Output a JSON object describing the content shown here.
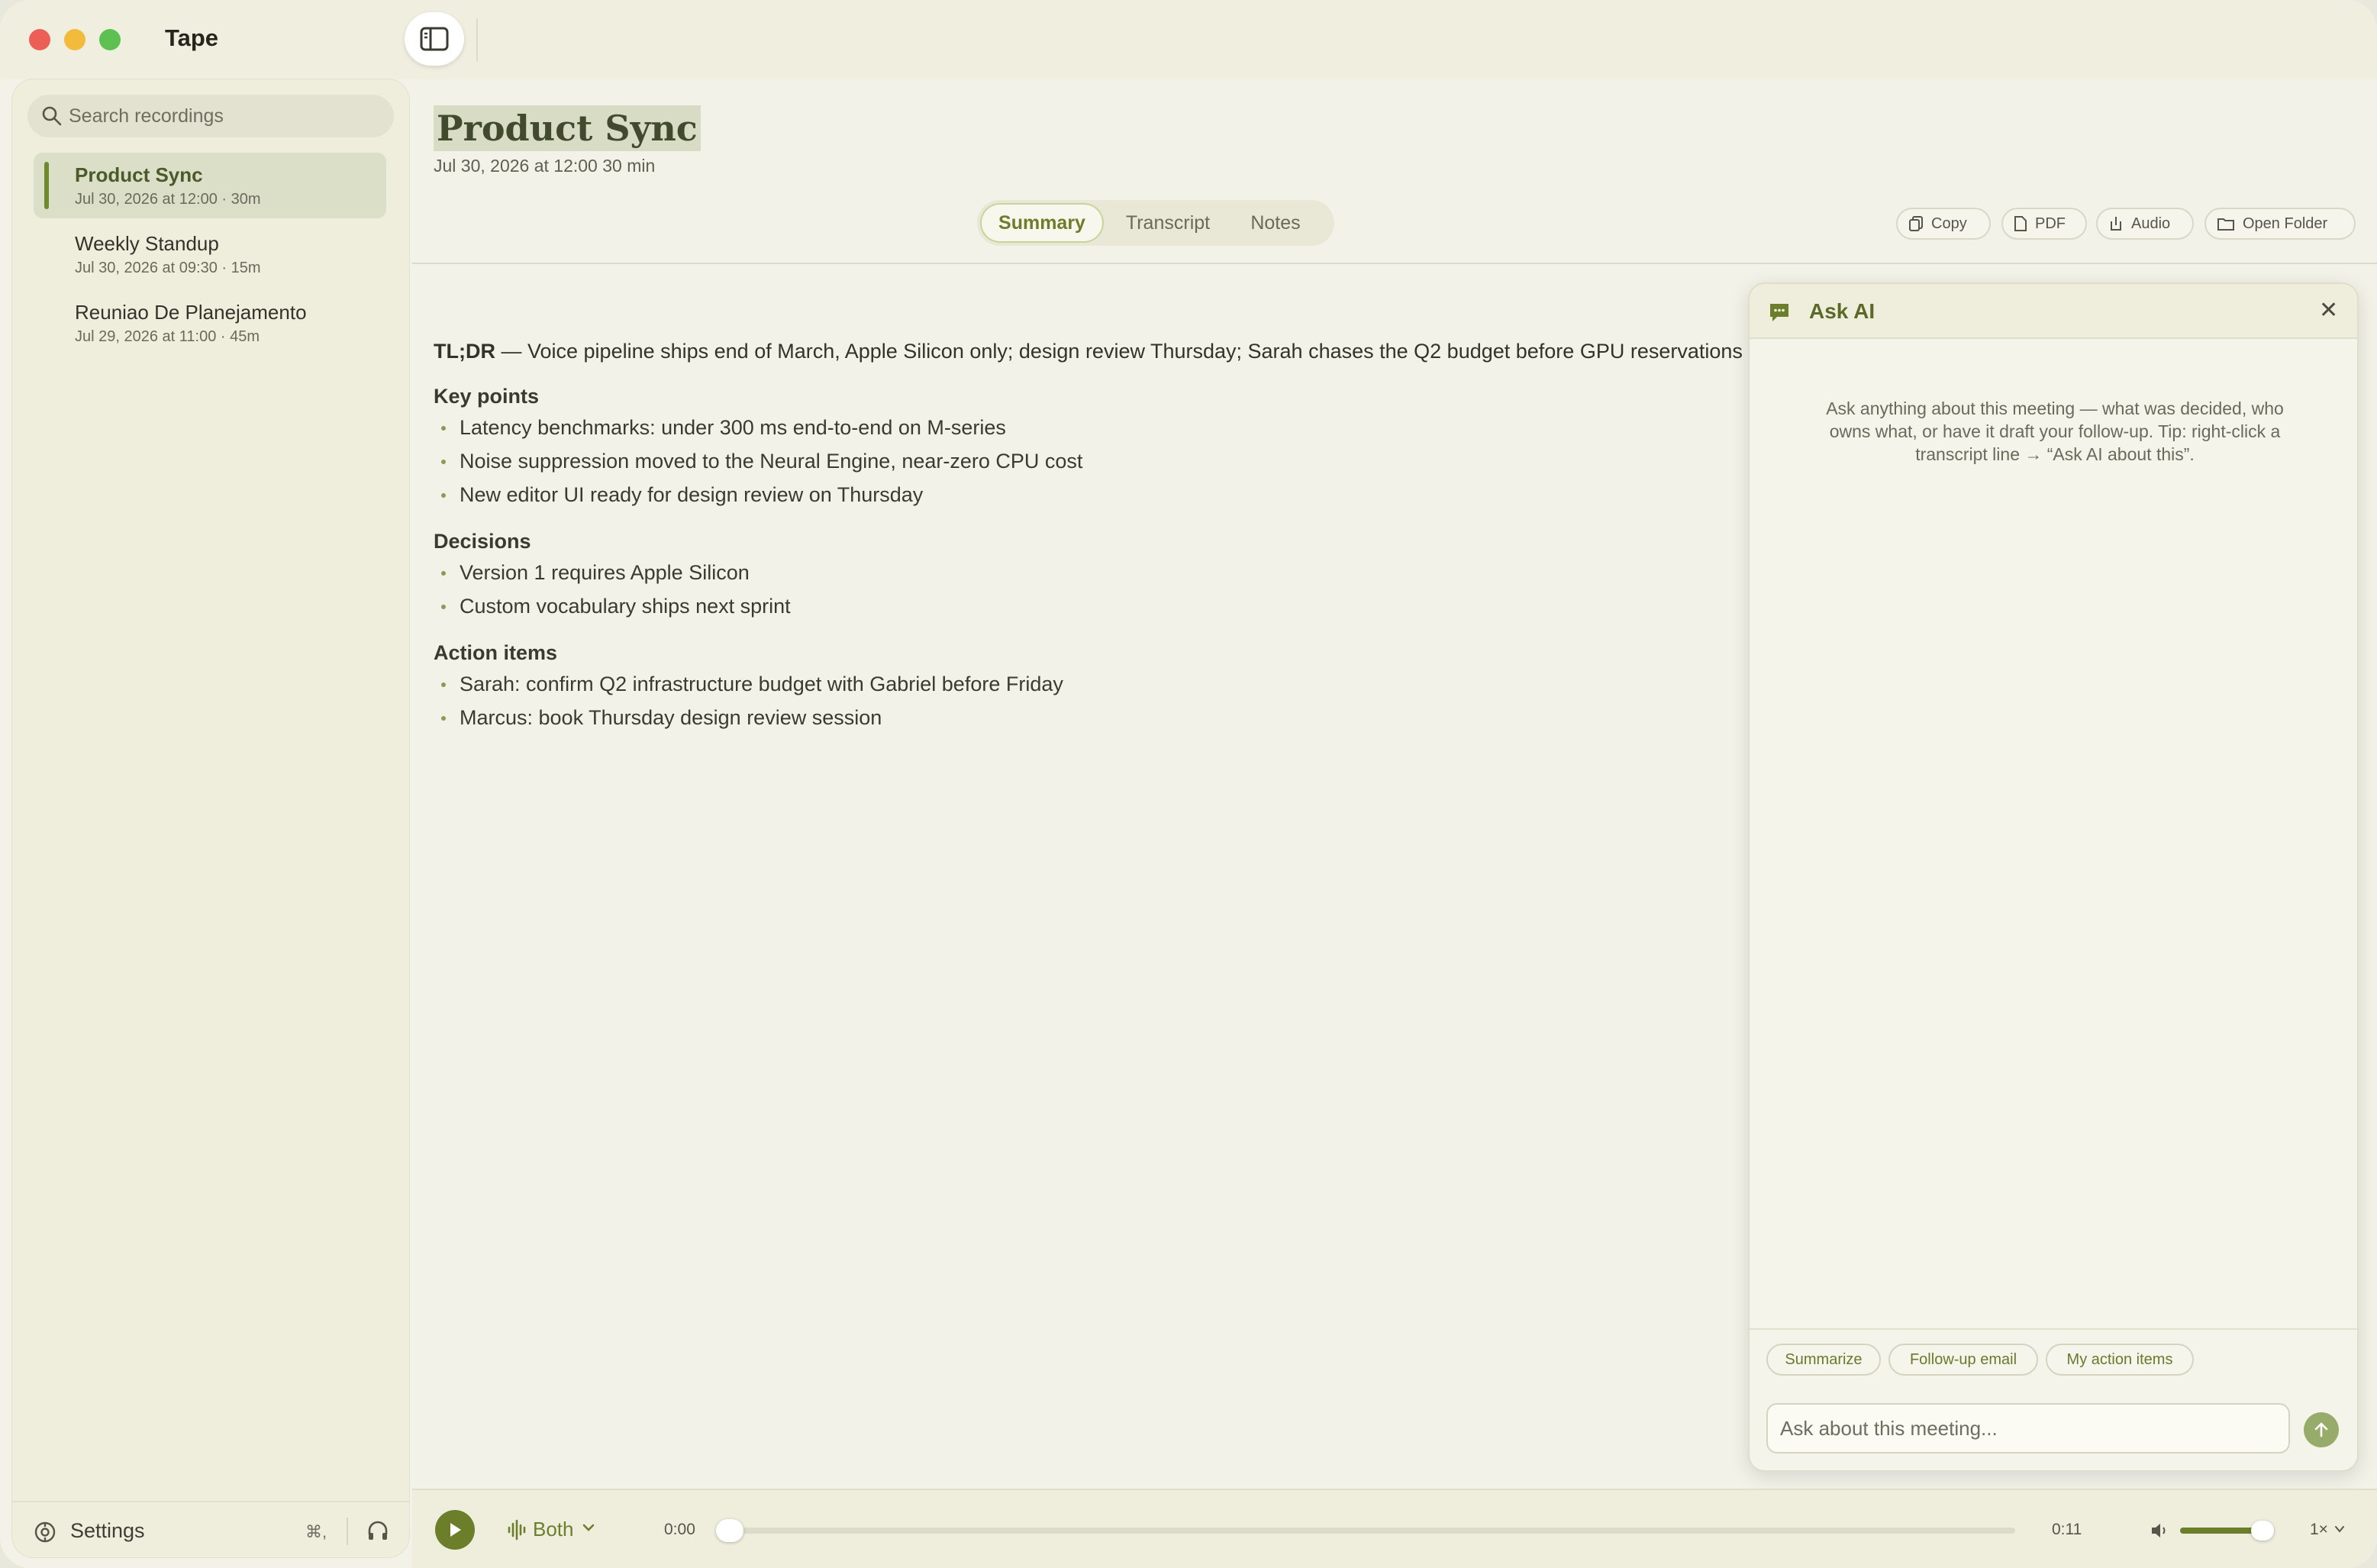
{
  "app": {
    "title": "Tape"
  },
  "sidebar": {
    "search_placeholder": "Search recordings",
    "recordings": [
      {
        "name": "Product Sync",
        "meta": "Jul 30, 2026 at 12:00  · 30m",
        "active": true
      },
      {
        "name": "Weekly Standup",
        "meta": "Jul 30, 2026 at 09:30  · 15m",
        "active": false
      },
      {
        "name": "Reuniao De Planejamento",
        "meta": "Jul 29, 2026 at 11:00  · 45m",
        "active": false
      }
    ],
    "footer": {
      "settings_label": "Settings",
      "shortcut": "⌘,"
    }
  },
  "document": {
    "title": "Product Sync",
    "meta": "Jul 30, 2026 at 12:00   30 min",
    "tabs": [
      "Summary",
      "Transcript",
      "Notes"
    ],
    "active_tab": "Summary",
    "actions": [
      "Copy",
      "PDF",
      "Audio",
      "Open Folder"
    ]
  },
  "summary": {
    "tldr_label": "TL;DR",
    "tldr_text": " — Voice pipeline ships end of March, Apple Silicon only; design review Thursday; Sarah chases the Q2 budget before GPU reservations",
    "sections": [
      {
        "heading": "Key points",
        "items": [
          "Latency benchmarks: under 300 ms end-to-end on M-series",
          "Noise suppression moved to the Neural Engine, near-zero CPU cost",
          "New editor UI ready for design review on Thursday"
        ]
      },
      {
        "heading": "Decisions",
        "items": [
          "Version 1 requires Apple Silicon",
          "Custom vocabulary ships next sprint"
        ]
      },
      {
        "heading": "Action items",
        "items": [
          "Sarah: confirm Q2 infrastructure budget with Gabriel before Friday",
          "Marcus: book Thursday design review session"
        ]
      }
    ]
  },
  "ask_ai": {
    "title": "Ask AI",
    "intro": "Ask anything about this meeting — what was decided, who owns what, or have it draft your follow-up. Tip: right-click a transcript line → “Ask AI about this”.",
    "suggestions": [
      "Summarize",
      "Follow-up email",
      "My action items"
    ],
    "input_placeholder": "Ask about this meeting..."
  },
  "player": {
    "source": "Both",
    "time_current": "0:00",
    "time_total": "0:11",
    "progress": 0.0,
    "volume": 0.85,
    "speed": "1×"
  },
  "colors": {
    "accent": "#6b7f2a",
    "accent_light": "#97ac6a",
    "background": "#f3f2e8",
    "sidebar": "#efeddc"
  }
}
